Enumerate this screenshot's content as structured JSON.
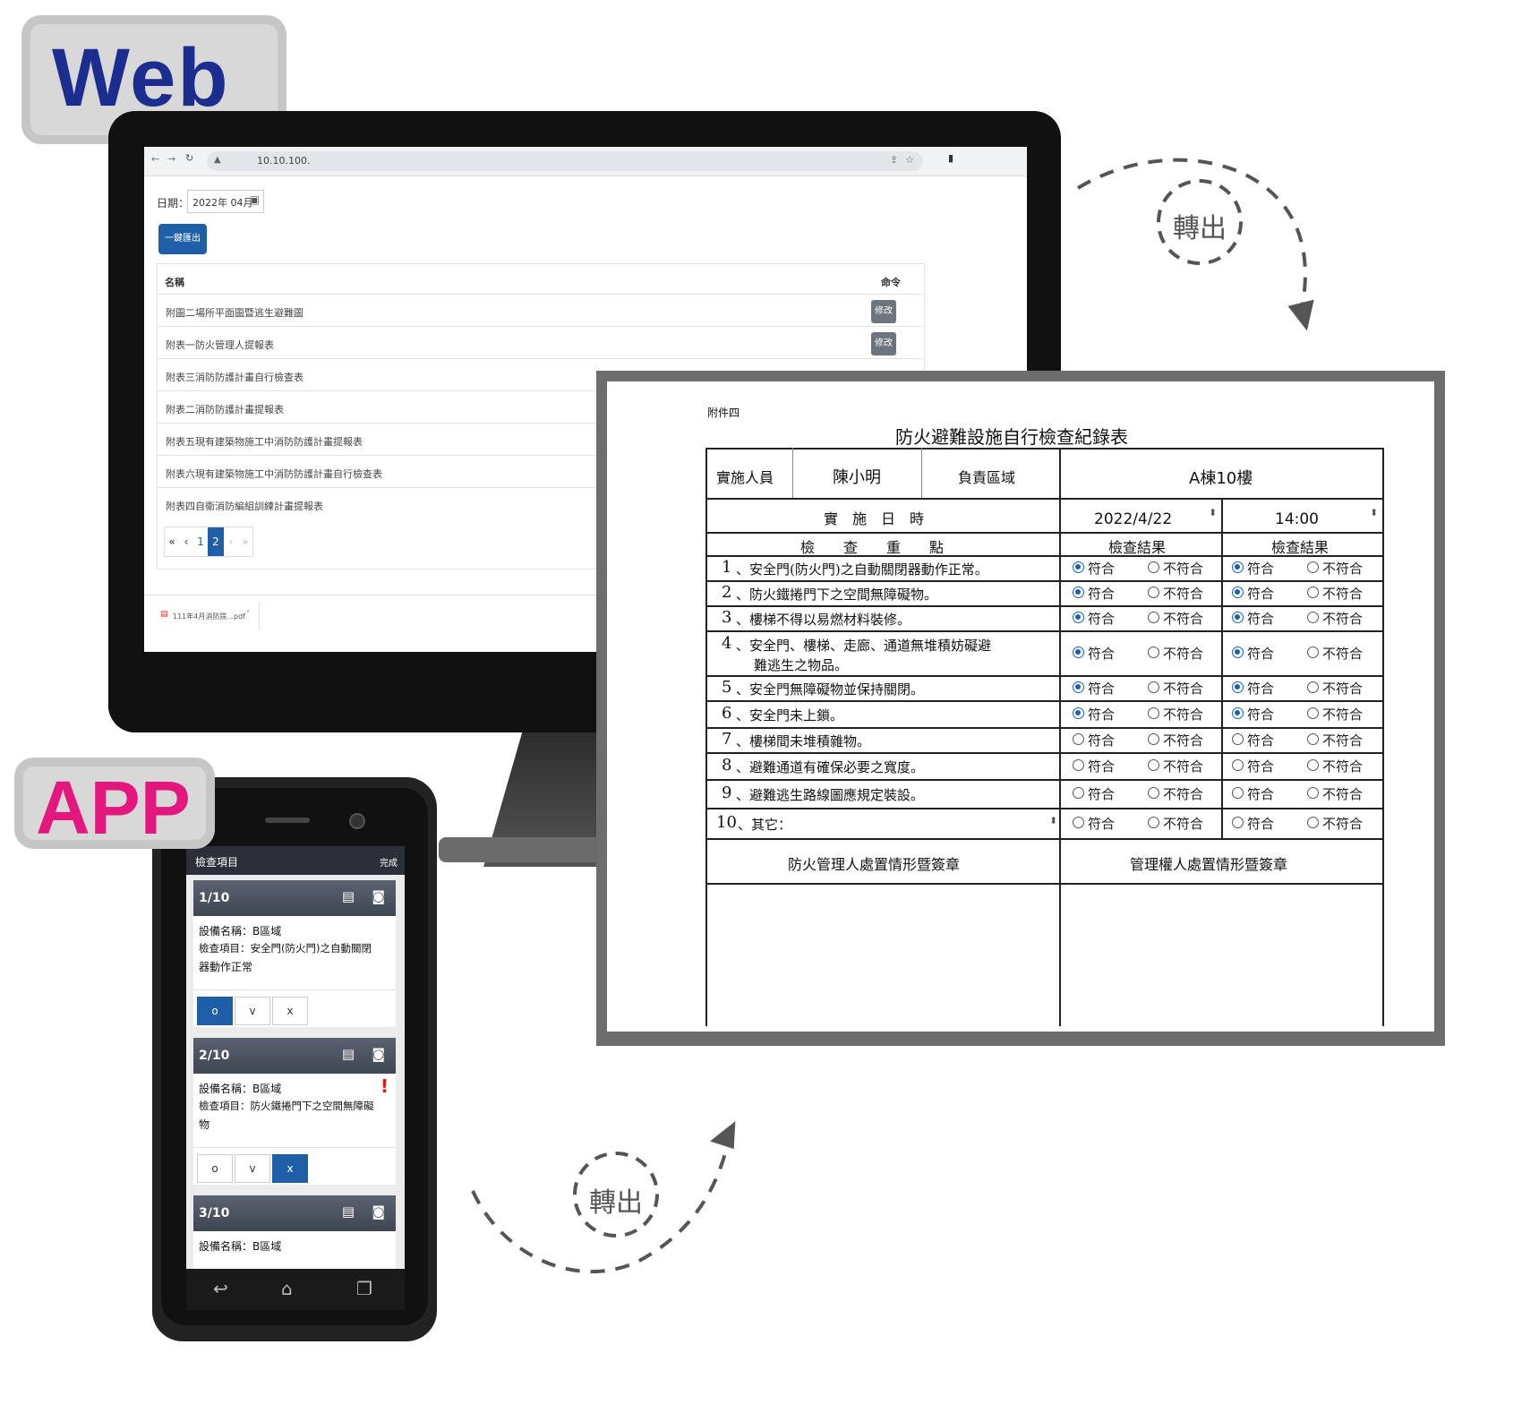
{
  "badges": {
    "web": "Web",
    "app": "APP"
  },
  "export_label_top": "轉出",
  "export_label_bottom": "轉出",
  "colors": {
    "web_badge": "#1b2d8f",
    "app_badge": "#e3177d",
    "accent_blue": "#1f5fa8"
  },
  "web": {
    "url": "10.10.100.",
    "date_label": "日期：",
    "date_value": "2022年 04月",
    "export_button": "一鍵匯出",
    "table_headers": {
      "name": "名稱",
      "command": "命令"
    },
    "rows": [
      {
        "name": "附圖二場所平面圖暨逃生避難圖",
        "action": "修改"
      },
      {
        "name": "附表一防火管理人提報表",
        "action": "修改"
      },
      {
        "name": "附表三消防防護計畫自行檢查表"
      },
      {
        "name": "附表二消防防護計畫提報表"
      },
      {
        "name": "附表五現有建築物施工中消防防護計畫提報表"
      },
      {
        "name": "附表六現有建築物施工中消防防護計畫自行檢查表"
      },
      {
        "name": "附表四自衛消防編組訓練計畫提報表"
      }
    ],
    "pagination": [
      "«",
      "‹",
      "1",
      "2",
      "›",
      "»"
    ],
    "download_file": "111年4月消防提...pdf"
  },
  "doc": {
    "attachment": "附件四",
    "title": "防火避難設施自行檢查紀錄表",
    "executor_label": "實施人員",
    "executor_value": "陳小明",
    "area_label": "負責區域",
    "area_value": "A棟10樓",
    "datetime_label": "實　施　日　時",
    "date_value": "2022/4/22",
    "time_value": "14:00",
    "points_header": "檢　　查　　重　　點",
    "result_header_1": "檢查結果",
    "result_header_2": "檢查結果",
    "opt_yes": "符合",
    "opt_no": "不符合",
    "items": [
      {
        "no": "1",
        "text": "、安全門(防火門)之自動關閉器動作正常。",
        "r1": "yes",
        "r2": "yes"
      },
      {
        "no": "2",
        "text": "、防火鐵捲門下之空間無障礙物。",
        "r1": "yes",
        "r2": "yes"
      },
      {
        "no": "3",
        "text": "、樓梯不得以易燃材料裝修。",
        "r1": "yes",
        "r2": "yes"
      },
      {
        "no": "4",
        "text": "、安全門、樓梯、走廊、通道無堆積妨礙避",
        "text2": "難逃生之物品。",
        "r1": "yes",
        "r2": "yes"
      },
      {
        "no": "5",
        "text": "、安全門無障礙物並保持關閉。",
        "r1": "yes",
        "r2": "yes"
      },
      {
        "no": "6",
        "text": "、安全門未上鎖。",
        "r1": "yes",
        "r2": "yes"
      },
      {
        "no": "7",
        "text": "、樓梯間未堆積雜物。",
        "r1": "none",
        "r2": "none"
      },
      {
        "no": "8",
        "text": "、避難通道有確保必要之寬度。",
        "r1": "none",
        "r2": "none"
      },
      {
        "no": "9",
        "text": "、避難逃生路線圖應規定裝設。",
        "r1": "none",
        "r2": "none"
      },
      {
        "no": "10",
        "text": "、其它：",
        "r1": "none",
        "r2": "none"
      }
    ],
    "sign_1": "防火管理人處置情形暨簽章",
    "sign_2": "管理權人處置情形暨簽章"
  },
  "app": {
    "title": "檢查項目",
    "done": "完成",
    "cards": [
      {
        "num": "1/10",
        "device": "設備名稱：B區域",
        "item": "檢查項目：安全門(防火門)之自動關閉",
        "item2": "器動作正常",
        "selected": "o"
      },
      {
        "num": "2/10",
        "device": "設備名稱：B區域",
        "item": "檢查項目：防火鐵捲門下之空間無障礙",
        "item2": "物",
        "selected": "x",
        "alert": "!"
      },
      {
        "num": "3/10",
        "device": "設備名稱：B區域"
      }
    ],
    "options": [
      "o",
      "v",
      "x"
    ]
  }
}
